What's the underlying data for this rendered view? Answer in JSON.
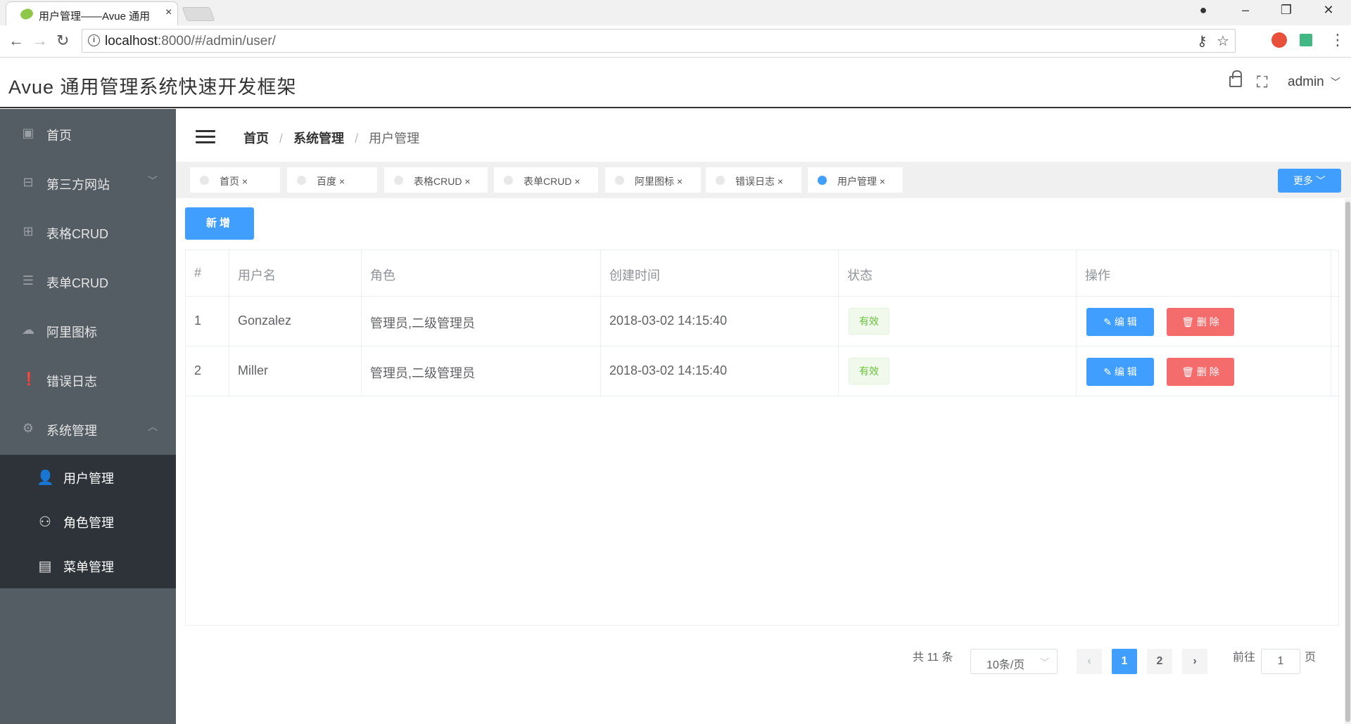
{
  "browser": {
    "tab_title": "用户管理——Avue 通用",
    "tab_close": "×",
    "url_host": "localhost",
    "url_rest": ":8000/#/admin/user/",
    "back": "←",
    "forward": "→",
    "reload": "↻",
    "info": "i",
    "key_icon": "⚷",
    "star_icon": "☆",
    "menu_icon": "⋮",
    "account_icon": "●",
    "minimize": "–",
    "restore": "❐",
    "close": "✕"
  },
  "header": {
    "title": "Avue 通用管理系统快速开发框架",
    "fullscreen_icon": "⛶",
    "user": "admin",
    "user_arrow": "﹀"
  },
  "sidebar": {
    "items": [
      {
        "label": "首页",
        "icon": "▣"
      },
      {
        "label": "第三方网站",
        "icon": "⊟",
        "arrow": "﹀"
      },
      {
        "label": "表格CRUD",
        "icon": "⊞"
      },
      {
        "label": "表单CRUD",
        "icon": "☰"
      },
      {
        "label": "阿里图标",
        "icon": "☁"
      },
      {
        "label": "错误日志",
        "icon": "❗"
      },
      {
        "label": "系统管理",
        "icon": "⚙",
        "arrow": "︿"
      }
    ],
    "submenu": [
      {
        "label": "用户管理",
        "icon": "👤"
      },
      {
        "label": "角色管理",
        "icon": "⚇"
      },
      {
        "label": "菜单管理",
        "icon": "▤"
      }
    ]
  },
  "breadcrumb": {
    "items": [
      "首页",
      "系统管理"
    ],
    "current": "用户管理",
    "sep": "/"
  },
  "tags": [
    {
      "label": "首页 ×"
    },
    {
      "label": "百度 ×"
    },
    {
      "label": "表格CRUD ×"
    },
    {
      "label": "表单CRUD ×"
    },
    {
      "label": "阿里图标 ×"
    },
    {
      "label": "错误日志 ×"
    },
    {
      "label": "用户管理 ×"
    }
  ],
  "more_label": "更多 ﹀",
  "add_label": "新增",
  "table": {
    "headers": [
      "#",
      "用户名",
      "角色",
      "创建时间",
      "状态",
      "操作"
    ],
    "rows": [
      {
        "index": "1",
        "username": "Gonzalez",
        "roles": "管理员,二级管理员",
        "created": "2018-03-02 14:15:40",
        "status": "有效"
      },
      {
        "index": "2",
        "username": "Miller",
        "roles": "管理员,二级管理员",
        "created": "2018-03-02 14:15:40",
        "status": "有效"
      }
    ],
    "edit_label": "✎ 编 辑",
    "delete_label": "🗑 删 除"
  },
  "pagination": {
    "total": "共 11 条",
    "page_size": "10条/页",
    "size_arrow": "﹀",
    "prev": "‹",
    "next": "›",
    "pages": [
      "1",
      "2"
    ],
    "goto_label": "前往",
    "goto_value": "1",
    "page_suffix": "页"
  },
  "colors": {
    "primary": "#409eff",
    "danger": "#f56c6c",
    "success": "#67c23a",
    "sidebar": "#545c64",
    "submenu": "#2d3339"
  }
}
